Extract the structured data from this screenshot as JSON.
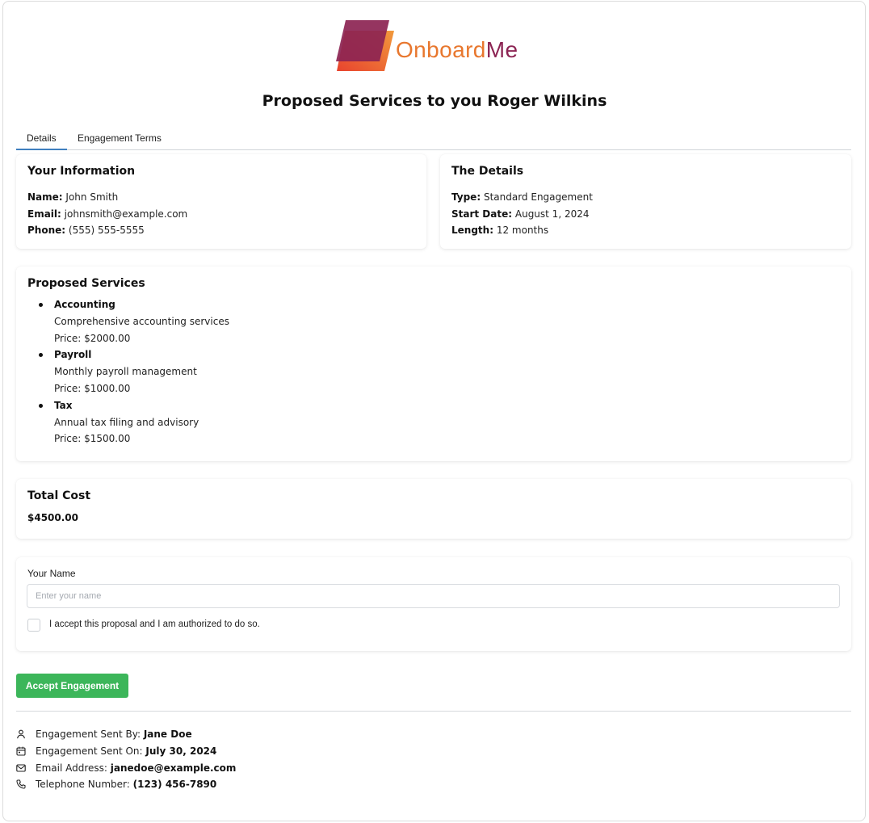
{
  "brand": {
    "logo_part1": "Onboard",
    "logo_part2": "Me",
    "colors": {
      "orange": "#e8772e",
      "plum": "#8c2453"
    }
  },
  "page_title": "Proposed Services to you Roger Wilkins",
  "tabs": [
    {
      "label": "Details",
      "active": true
    },
    {
      "label": "Engagement Terms",
      "active": false
    }
  ],
  "your_info": {
    "heading": "Your Information",
    "name_label": "Name:",
    "name_value": "John Smith",
    "email_label": "Email:",
    "email_value": "johnsmith@example.com",
    "phone_label": "Phone:",
    "phone_value": "(555) 555-5555"
  },
  "details": {
    "heading": "The Details",
    "type_label": "Type:",
    "type_value": "Standard Engagement",
    "start_label": "Start Date:",
    "start_value": "August 1, 2024",
    "length_label": "Length:",
    "length_value": "12 months"
  },
  "services": {
    "heading": "Proposed Services",
    "items": [
      {
        "name": "Accounting",
        "description": "Comprehensive accounting services",
        "price": "Price: $2000.00"
      },
      {
        "name": "Payroll",
        "description": "Monthly payroll management",
        "price": "Price: $1000.00"
      },
      {
        "name": "Tax",
        "description": "Annual tax filing and advisory",
        "price": "Price: $1500.00"
      }
    ]
  },
  "total": {
    "heading": "Total Cost",
    "value": "$4500.00"
  },
  "form": {
    "name_label": "Your Name",
    "name_placeholder": "Enter your name",
    "name_value": "",
    "checkbox_label": "I accept this proposal and I am authorized to do so.",
    "checkbox_checked": false
  },
  "accept_button": {
    "label": "Accept Engagement",
    "color": "#3cb65a"
  },
  "footer": {
    "sent_by_label": "Engagement Sent By:",
    "sent_by_value": "Jane Doe",
    "sent_on_label": "Engagement Sent On:",
    "sent_on_value": "July 30, 2024",
    "email_label": "Email Address:",
    "email_value": "janedoe@example.com",
    "phone_label": "Telephone Number:",
    "phone_value": "(123) 456-7890",
    "icons": [
      "user-icon",
      "calendar-icon",
      "mail-icon",
      "phone-icon"
    ]
  }
}
